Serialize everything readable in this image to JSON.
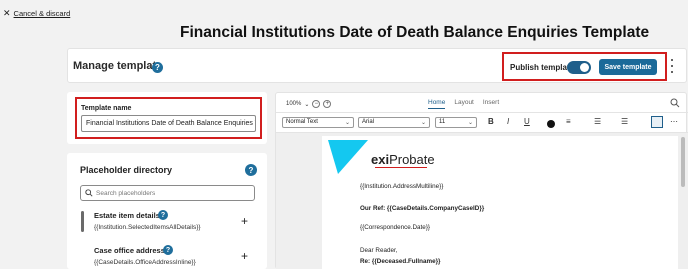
{
  "nav": {
    "cancel_label": "Cancel & discard"
  },
  "page": {
    "title": "Financial Institutions Date of Death Balance Enquiries Template"
  },
  "header": {
    "title": "Manage template",
    "publish_label": "Publish template",
    "publish_on": true,
    "save_label": "Save template"
  },
  "template_name": {
    "label": "Template name",
    "value": "Financial Institutions Date of Death Balance Enquiries Template"
  },
  "placeholders": {
    "title": "Placeholder directory",
    "search_placeholder": "Search placeholders",
    "items": [
      {
        "title": "Estate item details",
        "token": "{{Institution.SelectedItemsAllDetails}}"
      },
      {
        "title": "Case office address",
        "token": "{{CaseDetails.OfficeAddressInline}}"
      }
    ]
  },
  "editor": {
    "zoom": "100%",
    "tabs": [
      "Home",
      "Layout",
      "Insert"
    ],
    "active_tab": "Home",
    "style": "Normal Text",
    "font": "Arial",
    "size": "11",
    "bold": "B",
    "italic": "I",
    "underline": "U",
    "logo": {
      "prefix": "exi",
      "suffix": "Probate"
    },
    "lines": [
      "{{Institution.AddressMultiline}}",
      "Our Ref: {{CaseDetails.CompanyCaseID}}",
      "{{Correspondence.Date}}",
      "Dear Reader,",
      "Re: {{Deceased.Fullname}}"
    ]
  },
  "colors": {
    "accent": "#1b6a99",
    "highlight": "#d11e1e",
    "logo_cyan": "#14c8f0"
  }
}
